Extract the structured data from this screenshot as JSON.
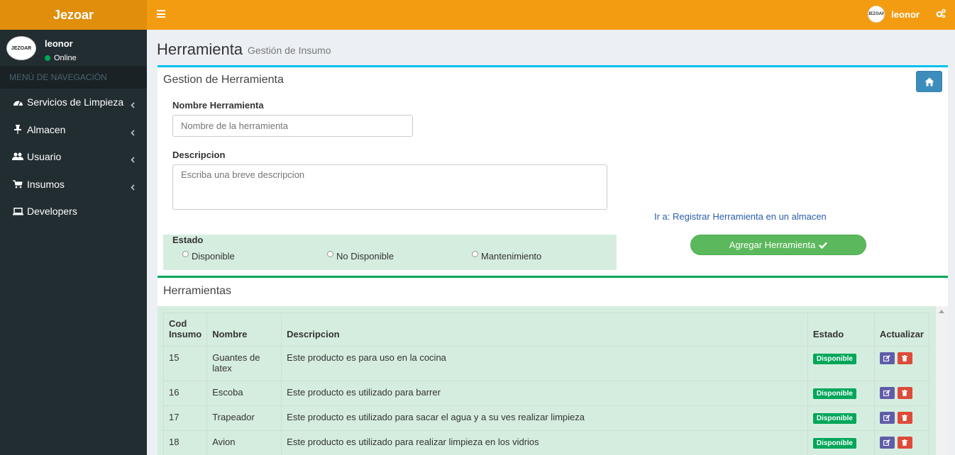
{
  "app": {
    "logo": "Jezoar"
  },
  "header": {
    "user_name": "leonor",
    "avatar_text": "JEZOAR"
  },
  "sidebar": {
    "user_name": "leonor",
    "user_status": "Online",
    "avatar_text": "JEZOAR",
    "nav_header": "MENÚ DE NAVEGACIÓN",
    "items": [
      {
        "label": "Servicios de Limpieza",
        "icon": "dashboard-icon",
        "has_chevron": true
      },
      {
        "label": "Almacen",
        "icon": "pin-icon",
        "has_chevron": true
      },
      {
        "label": "Usuario",
        "icon": "users-icon",
        "has_chevron": true
      },
      {
        "label": "Insumos",
        "icon": "cart-icon",
        "has_chevron": true
      },
      {
        "label": "Developers",
        "icon": "laptop-icon",
        "has_chevron": false
      }
    ]
  },
  "page": {
    "title": "Herramienta",
    "subtitle": "Gestión de Insumo"
  },
  "form": {
    "box_title": "Gestion de Herramienta",
    "name_label": "Nombre Herramienta",
    "name_placeholder": "Nombre de la herramienta",
    "name_value": "",
    "desc_label": "Descripcion",
    "desc_placeholder": "Escriba una breve descripcion",
    "desc_value": "",
    "estado_label": "Estado",
    "estado_options": [
      "Disponible",
      "No Disponible",
      "Mantenimiento"
    ],
    "link_text": "Ir a: Registrar Herramienta en un almacen",
    "submit_label": "Agregar Herramienta"
  },
  "list": {
    "box_title": "Herramientas",
    "columns": [
      "Cod Insumo",
      "Nombre",
      "Descripcion",
      "Estado",
      "Actualizar"
    ],
    "rows": [
      {
        "cod": "15",
        "nombre": "Guantes de latex",
        "descripcion": "Este producto es para uso en la cocina",
        "estado": "Disponible"
      },
      {
        "cod": "16",
        "nombre": "Escoba",
        "descripcion": "Este producto es utilizado para barrer",
        "estado": "Disponible"
      },
      {
        "cod": "17",
        "nombre": "Trapeador",
        "descripcion": "Este producto es utilizado para sacar el agua y a su ves realizar limpieza",
        "estado": "Disponible"
      },
      {
        "cod": "18",
        "nombre": "Avion",
        "descripcion": "Este producto es utilizado para realizar limpieza en los vidrios",
        "estado": "Disponible"
      }
    ]
  },
  "colors": {
    "header": "#f39c12",
    "logo_bg": "#e08e0b",
    "sidebar": "#222d32",
    "badge": "#00a65a",
    "submit": "#5cb85c",
    "home_btn": "#3c8dbc"
  }
}
